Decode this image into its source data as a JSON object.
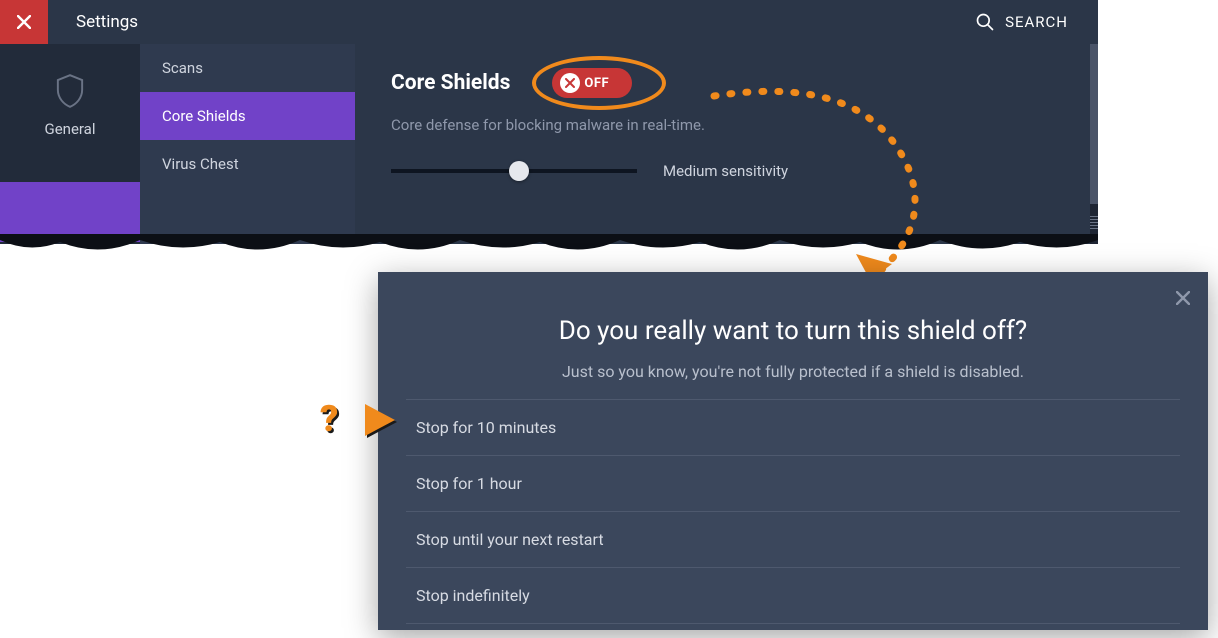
{
  "titlebar": {
    "title": "Settings",
    "search": "SEARCH"
  },
  "leftNav": {
    "general": "General"
  },
  "subNav": {
    "items": [
      "Scans",
      "Core Shields",
      "Virus Chest"
    ],
    "activeIndex": 1
  },
  "content": {
    "title": "Core Shields",
    "toggle": {
      "state": "OFF"
    },
    "description": "Core defense for blocking malware in real-time.",
    "sensitivity": "Medium sensitivity"
  },
  "dialog": {
    "title": "Do you really want to turn this shield off?",
    "subtitle": "Just so you know, you're not fully protected if a shield is disabled.",
    "options": [
      "Stop for 10 minutes",
      "Stop for 1 hour",
      "Stop until your next restart",
      "Stop indefinitely"
    ]
  },
  "annotation": {
    "question": "?"
  }
}
